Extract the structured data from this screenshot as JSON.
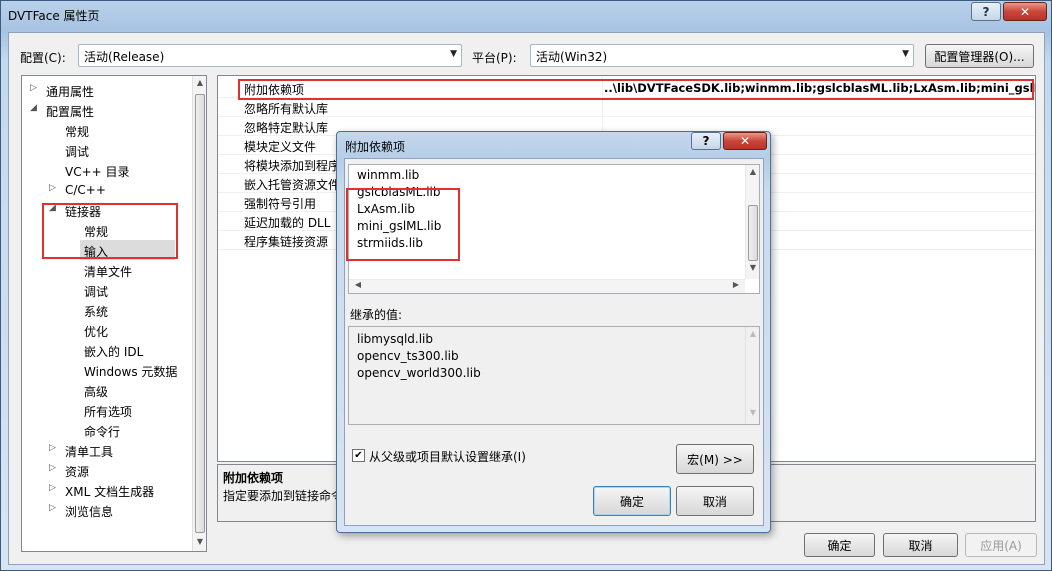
{
  "window": {
    "title": "DVTFace 属性页",
    "help_glyph": "?",
    "close_glyph": "✕"
  },
  "toolbar": {
    "config_label": "配置(C):",
    "config_value": "活动(Release)",
    "platform_label": "平台(P):",
    "platform_value": "活动(Win32)",
    "config_manager_label": "配置管理器(O)..."
  },
  "tree": {
    "items": [
      {
        "label": "通用属性",
        "level": 0,
        "expander": "▷"
      },
      {
        "label": "配置属性",
        "level": 0,
        "expander": "◢"
      },
      {
        "label": "常规",
        "level": 1,
        "expander": ""
      },
      {
        "label": "调试",
        "level": 1,
        "expander": ""
      },
      {
        "label": "VC++ 目录",
        "level": 1,
        "expander": ""
      },
      {
        "label": "C/C++",
        "level": 1,
        "expander": "▷"
      },
      {
        "label": "链接器",
        "level": 1,
        "expander": "◢"
      },
      {
        "label": "常规",
        "level": 2,
        "expander": ""
      },
      {
        "label": "输入",
        "level": 2,
        "expander": ""
      },
      {
        "label": "清单文件",
        "level": 2,
        "expander": ""
      },
      {
        "label": "调试",
        "level": 2,
        "expander": ""
      },
      {
        "label": "系统",
        "level": 2,
        "expander": ""
      },
      {
        "label": "优化",
        "level": 2,
        "expander": ""
      },
      {
        "label": "嵌入的 IDL",
        "level": 2,
        "expander": ""
      },
      {
        "label": "Windows 元数据",
        "level": 2,
        "expander": ""
      },
      {
        "label": "高级",
        "level": 2,
        "expander": ""
      },
      {
        "label": "所有选项",
        "level": 2,
        "expander": ""
      },
      {
        "label": "命令行",
        "level": 2,
        "expander": ""
      },
      {
        "label": "清单工具",
        "level": 1,
        "expander": "▷"
      },
      {
        "label": "资源",
        "level": 1,
        "expander": "▷"
      },
      {
        "label": "XML 文档生成器",
        "level": 1,
        "expander": "▷"
      },
      {
        "label": "浏览信息",
        "level": 1,
        "expander": "▷"
      }
    ],
    "selected_index": 8
  },
  "grid": {
    "rows": [
      {
        "name": "附加依赖项",
        "value": "..\\lib\\DVTFaceSDK.lib;winmm.lib;gslcblasML.lib;LxAsm.lib;mini_gslML"
      },
      {
        "name": "忽略所有默认库",
        "value": ""
      },
      {
        "name": "忽略特定默认库",
        "value": ""
      },
      {
        "name": "模块定义文件",
        "value": ""
      },
      {
        "name": "将模块添加到程序",
        "value": ""
      },
      {
        "name": "嵌入托管资源文件",
        "value": ""
      },
      {
        "name": "强制符号引用",
        "value": ""
      },
      {
        "name": "延迟加载的 DLL",
        "value": ""
      },
      {
        "name": "程序集链接资源",
        "value": ""
      }
    ]
  },
  "description": {
    "title": "附加依赖项",
    "text": "指定要添加到链接命令"
  },
  "dialog": {
    "title": "附加依赖项",
    "help_glyph": "?",
    "close_glyph": "✕",
    "edit_lines": [
      "winmm.lib",
      "gslcblasML.lib",
      "LxAsm.lib",
      "mini_gslML.lib",
      "strmiids.lib"
    ],
    "inherited_label": "继承的值:",
    "inherited_lines": [
      "libmysqld.lib",
      "opencv_ts300.lib",
      "opencv_world300.lib"
    ],
    "inherit_checkbox_label": "从父级或项目默认设置继承(I)",
    "inherit_checked": true,
    "macro_button": "宏(M) >>",
    "ok_button": "确定",
    "cancel_button": "取消"
  },
  "footer": {
    "ok_button": "确定",
    "cancel_button": "取消",
    "apply_button": "应用(A)"
  },
  "colors": {
    "highlight_box": "#e03030",
    "selected_tree_bg": "#dcdcdc"
  }
}
